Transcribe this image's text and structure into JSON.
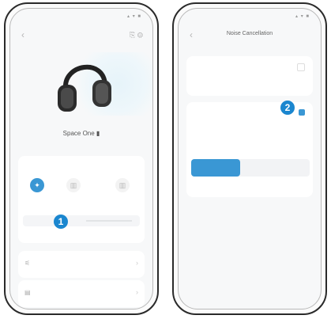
{
  "left_phone": {
    "status": {
      "time": "",
      "icons": "▴ ▾ ■"
    },
    "device_name": "Space One",
    "section_title": "",
    "modes": [
      {
        "label": "",
        "active": true
      },
      {
        "label": "",
        "active": false
      },
      {
        "label": "",
        "active": false
      }
    ],
    "level_label": "",
    "badge": "1",
    "list": [
      {
        "label": "",
        "sub": ""
      },
      {
        "label": "",
        "sub": ""
      }
    ]
  },
  "right_phone": {
    "status": {
      "time": "",
      "icons": "▴ ▾ ■"
    },
    "title": "Noise Cancellation",
    "option1": {
      "title": "",
      "desc": ""
    },
    "option2": {
      "title": "",
      "desc": ""
    },
    "badge": "2",
    "segments": [
      "",
      "",
      ""
    ],
    "scale": {
      "left": "",
      "right": ""
    }
  },
  "colors": {
    "accent": "#3a97d4",
    "badge": "#1a86cf"
  }
}
